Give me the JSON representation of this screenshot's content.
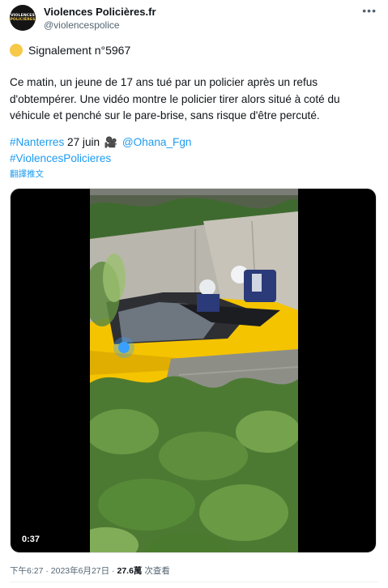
{
  "account": {
    "display_name": "Violences Policières.fr",
    "handle": "@violencespolice",
    "avatar_line1": "VIOLENCES",
    "avatar_line2": "POLICIÈRES"
  },
  "header": {
    "more_icon": "more-icon"
  },
  "tweet": {
    "report_icon": "yellow-circle-emoji",
    "report_label": "Signalement n°5967",
    "body": "Ce matin, un jeune de 17 ans tué par un policier après un refus d'obtempérer. Une vidéo montre le policier tirer alors situé à coté du véhicule et penché sur le pare-brise, sans risque d'être percuté.",
    "hashtag_1": "#Nanterres",
    "date_text": " 27 juin ",
    "camera_icon": "🎥",
    "mention": "@Ohana_Fgn",
    "hashtag_2": "#ViolencesPolicieres",
    "translate_label": "翻譯推文"
  },
  "media": {
    "duration": "0:37"
  },
  "footer": {
    "timestamp": "下午6:27 · 2023年6月27日 · ",
    "views_count": "27.6萬",
    "views_label": " 次查看"
  },
  "colors": {
    "link": "#1d9bf0",
    "secondary_text": "#536471",
    "primary_text": "#0f1419",
    "car_yellow": "#f5c400"
  }
}
